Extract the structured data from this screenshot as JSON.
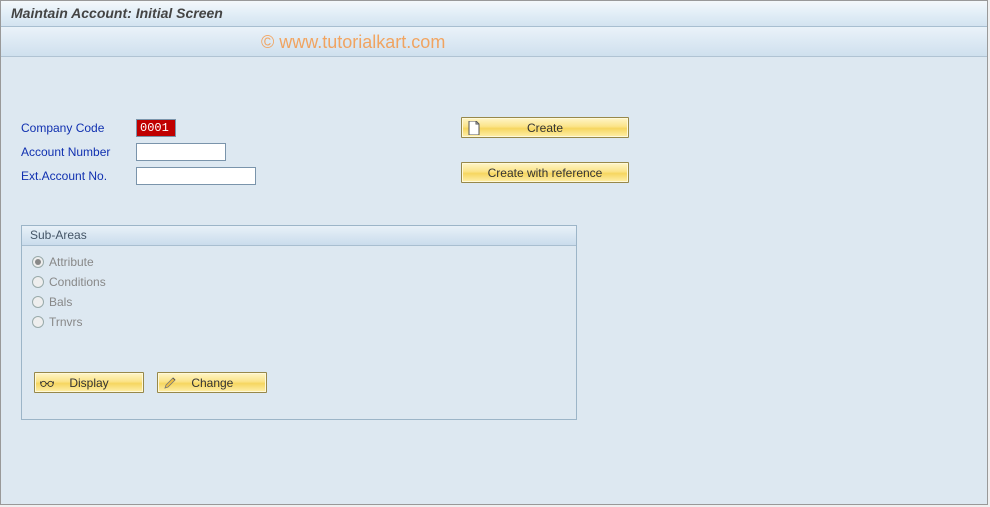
{
  "header": {
    "title": "Maintain Account: Initial Screen"
  },
  "watermark": "© www.tutorialkart.com",
  "fields": {
    "company_code": {
      "label": "Company Code",
      "value": "0001"
    },
    "account_number": {
      "label": "Account Number",
      "value": ""
    },
    "ext_account_no": {
      "label": "Ext.Account No.",
      "value": ""
    }
  },
  "buttons": {
    "create": "Create",
    "create_ref": "Create with reference",
    "display": "Display",
    "change": "Change"
  },
  "panel": {
    "title": "Sub-Areas",
    "options": {
      "attribute": {
        "label": "Attribute",
        "selected": true
      },
      "conditions": {
        "label": "Conditions",
        "selected": false
      },
      "bals": {
        "label": "Bals",
        "selected": false
      },
      "trnvrs": {
        "label": "Trnvrs",
        "selected": false
      }
    }
  }
}
